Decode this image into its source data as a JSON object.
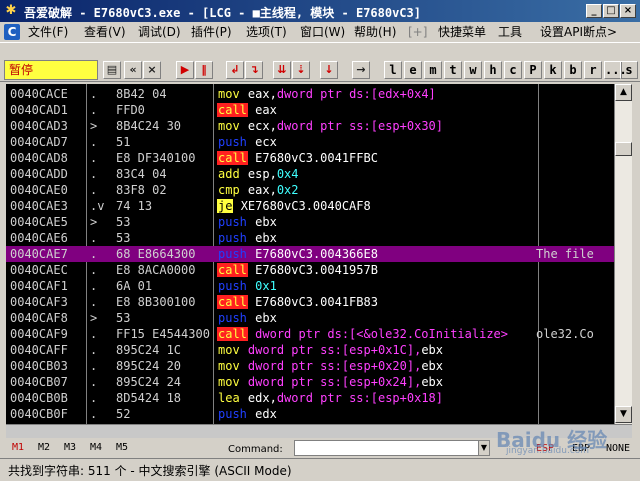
{
  "window": {
    "title": "吾爱破解 - E7680vC3.exe - [LCG - ■主线程, 模块 - E7680vC3]",
    "controls": [
      "_",
      "□",
      "×"
    ]
  },
  "menu": {
    "items": [
      "文件(F)",
      "查看(V)",
      "调试(D)",
      "插件(P)",
      "选项(T)",
      "窗口(W)",
      "帮助(H)",
      "[+]",
      "快捷菜单",
      "工具",
      "设置API断点>"
    ]
  },
  "toolbar": {
    "status": "暂停",
    "letters": [
      "l",
      "e",
      "m",
      "t",
      "w",
      "h",
      "c",
      "P",
      "k",
      "b",
      "r",
      "...",
      "s"
    ]
  },
  "disassembly": {
    "rows": [
      {
        "addr": "0040CACE",
        "mark": ".",
        "hex": "8B42 04",
        "mnem": "mov",
        "ops": [
          [
            "w",
            "eax,"
          ],
          [
            "m",
            "dword ptr ds:[edx+0x4]"
          ]
        ],
        "comment": ""
      },
      {
        "addr": "0040CAD1",
        "mark": ".",
        "hex": "FFD0",
        "mnem": "call",
        "ops": [
          [
            "w",
            "eax"
          ]
        ],
        "comment": ""
      },
      {
        "addr": "0040CAD3",
        "mark": ">",
        "hex": "8B4C24 30",
        "mnem": "mov",
        "ops": [
          [
            "w",
            "ecx,"
          ],
          [
            "m",
            "dword ptr ss:[esp+0x30]"
          ]
        ],
        "comment": ""
      },
      {
        "addr": "0040CAD7",
        "mark": ".",
        "hex": "51",
        "mnem": "push",
        "ops": [
          [
            "w",
            "ecx"
          ]
        ],
        "comment": ""
      },
      {
        "addr": "0040CAD8",
        "mark": ".",
        "hex": "E8 DF340100",
        "mnem": "call",
        "ops": [
          [
            "w",
            "E7680vC3.0041FFBC"
          ]
        ],
        "comment": ""
      },
      {
        "addr": "0040CADD",
        "mark": ".",
        "hex": "83C4 04",
        "mnem": "add",
        "ops": [
          [
            "w",
            "esp,"
          ],
          [
            "c",
            "0x4"
          ]
        ],
        "comment": ""
      },
      {
        "addr": "0040CAE0",
        "mark": ".",
        "hex": "83F8 02",
        "mnem": "cmp",
        "ops": [
          [
            "w",
            "eax,"
          ],
          [
            "c",
            "0x2"
          ]
        ],
        "comment": ""
      },
      {
        "addr": "0040CAE3",
        "mark": ".v",
        "hex": "74 13",
        "mnem": "je",
        "ops": [
          [
            "w",
            "XE7680vC3.0040CAF8"
          ]
        ],
        "comment": ""
      },
      {
        "addr": "0040CAE5",
        "mark": ">",
        "hex": "53",
        "mnem": "push",
        "ops": [
          [
            "w",
            "ebx"
          ]
        ],
        "comment": ""
      },
      {
        "addr": "0040CAE6",
        "mark": ".",
        "hex": "53",
        "mnem": "push",
        "ops": [
          [
            "w",
            "ebx"
          ]
        ],
        "comment": ""
      },
      {
        "addr": "0040CAE7",
        "mark": ".",
        "hex": "68 E8664300",
        "mnem": "push",
        "ops": [
          [
            "w",
            "E7680vC3.004366E8"
          ]
        ],
        "comment": "The file",
        "selected": true
      },
      {
        "addr": "0040CAEC",
        "mark": ".",
        "hex": "E8 8ACA0000",
        "mnem": "call",
        "ops": [
          [
            "w",
            "E7680vC3.0041957B"
          ]
        ],
        "comment": ""
      },
      {
        "addr": "0040CAF1",
        "mark": ".",
        "hex": "6A 01",
        "mnem": "push",
        "ops": [
          [
            "c",
            "0x1"
          ]
        ],
        "comment": ""
      },
      {
        "addr": "0040CAF3",
        "mark": ".",
        "hex": "E8 8B300100",
        "mnem": "call",
        "ops": [
          [
            "w",
            "E7680vC3.0041FB83"
          ]
        ],
        "comment": ""
      },
      {
        "addr": "0040CAF8",
        "mark": ">",
        "hex": "53",
        "mnem": "push",
        "ops": [
          [
            "w",
            "ebx"
          ]
        ],
        "comment": ""
      },
      {
        "addr": "0040CAF9",
        "mark": ".",
        "hex": "FF15 E4544300",
        "mnem": "call",
        "ops": [
          [
            "m",
            "dword ptr ds:[<&ole32.CoInitialize>"
          ]
        ],
        "comment": "ole32.Co"
      },
      {
        "addr": "0040CAFF",
        "mark": ".",
        "hex": "895C24 1C",
        "mnem": "mov",
        "ops": [
          [
            "m",
            "dword ptr ss:[esp+0x1C],"
          ],
          [
            "w",
            "ebx"
          ]
        ],
        "comment": ""
      },
      {
        "addr": "0040CB03",
        "mark": ".",
        "hex": "895C24 20",
        "mnem": "mov",
        "ops": [
          [
            "m",
            "dword ptr ss:[esp+0x20],"
          ],
          [
            "w",
            "ebx"
          ]
        ],
        "comment": ""
      },
      {
        "addr": "0040CB07",
        "mark": ".",
        "hex": "895C24 24",
        "mnem": "mov",
        "ops": [
          [
            "m",
            "dword ptr ss:[esp+0x24],"
          ],
          [
            "w",
            "ebx"
          ]
        ],
        "comment": ""
      },
      {
        "addr": "0040CB0B",
        "mark": ".",
        "hex": "8D5424 18",
        "mnem": "lea",
        "ops": [
          [
            "w",
            "edx,"
          ],
          [
            "m",
            "dword ptr ss:[esp+0x18]"
          ]
        ],
        "comment": ""
      },
      {
        "addr": "0040CB0F",
        "mark": ".",
        "hex": "52",
        "mnem": "push",
        "ops": [
          [
            "w",
            "edx"
          ]
        ],
        "comment": ""
      }
    ]
  },
  "bottom": {
    "tabs": [
      "M1",
      "M2",
      "M3",
      "M4",
      "M5"
    ],
    "command_label": "Command:",
    "command_value": "",
    "registers": [
      "ESP",
      "EBP",
      "NONE"
    ]
  },
  "statusbar": {
    "text": "共找到字符串: 511 个  -  中文搜索引擎 (ASCII Mode)"
  },
  "watermark": {
    "brand": "Baidu 经验",
    "site": "jingyan.baidu.com"
  },
  "colors": {
    "title_start": "#0a246a",
    "selected_row": "#800080",
    "call_bg": "#ff2020",
    "mnemonic": "#ffff40",
    "push": "#2040ff",
    "memory_operand": "#ff40ff",
    "constant": "#40ffff"
  }
}
